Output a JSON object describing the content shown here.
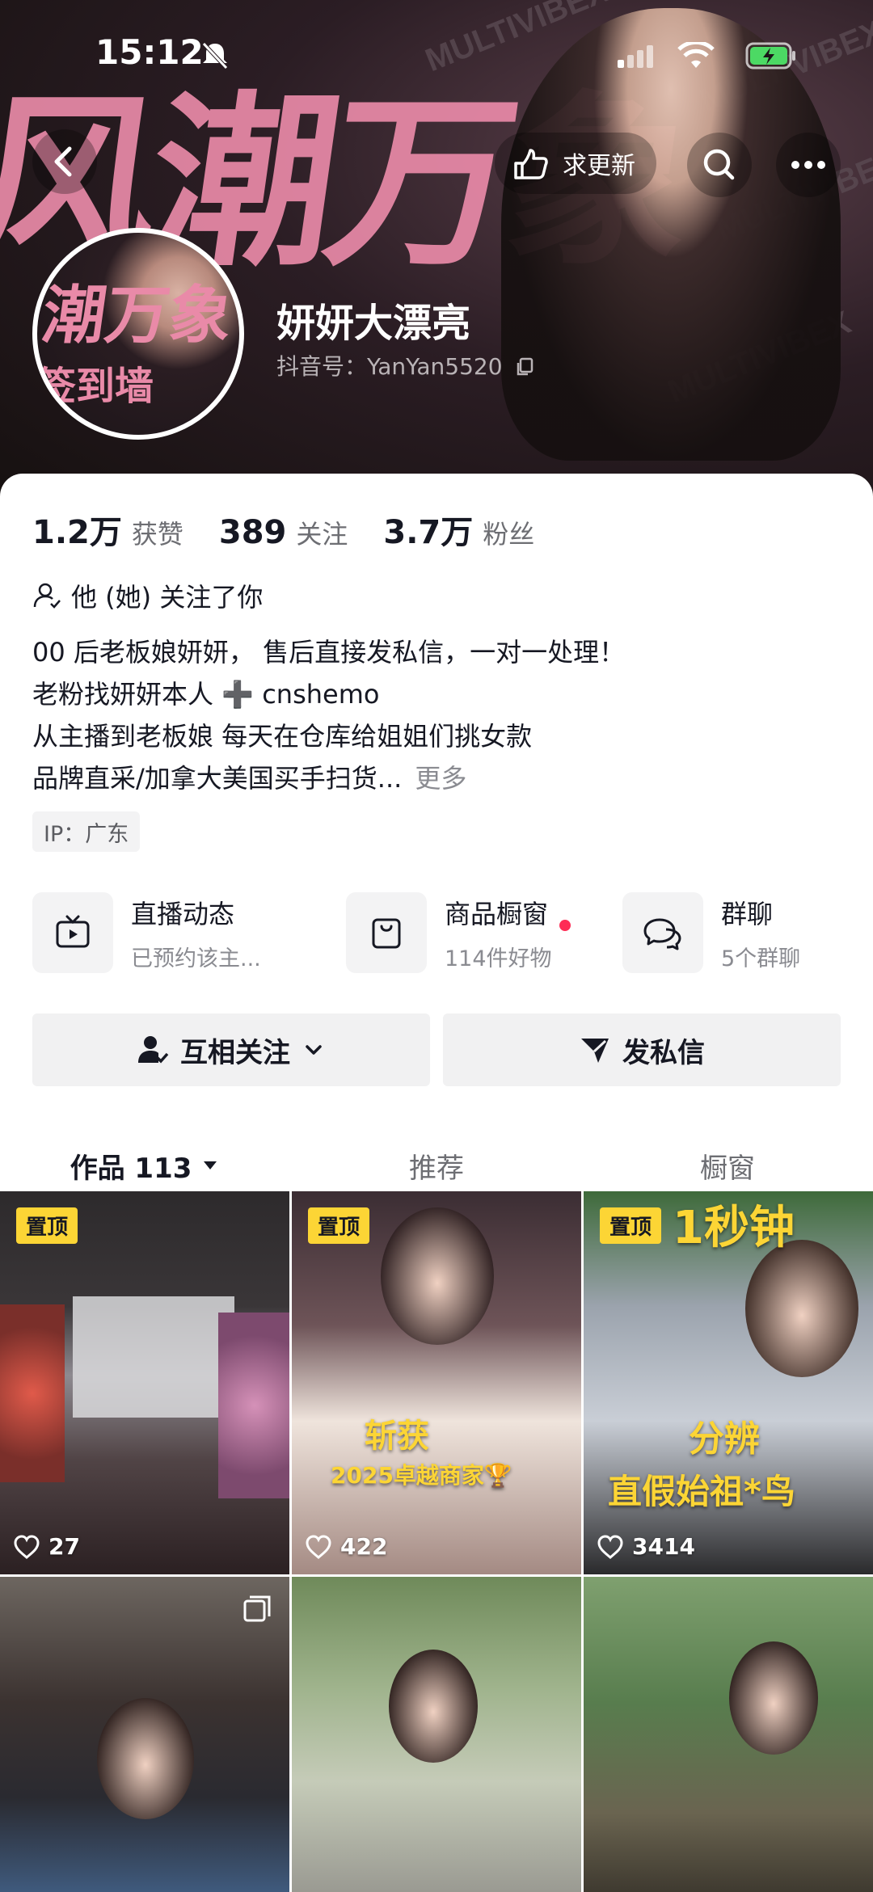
{
  "status_bar": {
    "time": "15:12"
  },
  "banner": {
    "big_text": "风潮万象",
    "brand": "MULTIVIBEX",
    "avatar_text": "潮万象",
    "avatar_subtext": "签到墙"
  },
  "nav": {
    "update_label": "求更新"
  },
  "profile": {
    "name": "妍妍大漂亮",
    "douyin_id": "抖音号：YanYan5520"
  },
  "stats": [
    {
      "value": "1.2万",
      "label": "获赞"
    },
    {
      "value": "389",
      "label": "关注"
    },
    {
      "value": "3.7万",
      "label": "粉丝"
    }
  ],
  "follow_note": "他 (她) 关注了你",
  "bio": {
    "lines": [
      "00 后老板娘妍妍， 售后直接发私信，一对一处理！",
      "老粉找妍妍本人 ➕ cnshemo",
      "从主播到老板娘 每天在仓库给姐姐们挑女款",
      "品牌直采/加拿大美国买手扫货..."
    ],
    "more": "更多"
  },
  "ip": "IP：广东",
  "services": [
    {
      "title": "直播动态",
      "subtitle": "已预约该主...",
      "icon": "tv-icon"
    },
    {
      "title": "商品橱窗",
      "subtitle": "114件好物",
      "icon": "bag-icon"
    },
    {
      "title": "群聊",
      "subtitle": "5个群聊",
      "icon": "chat-icon"
    }
  ],
  "actions": {
    "mutual_follow": "互相关注",
    "message": "发私信"
  },
  "tabs": [
    {
      "label": "作品 113",
      "active": true
    },
    {
      "label": "推荐",
      "active": false
    },
    {
      "label": "橱窗",
      "active": false
    }
  ],
  "videos": [
    {
      "pinned": "置顶",
      "likes": "27"
    },
    {
      "pinned": "置顶",
      "likes": "422",
      "caption1": "斩获",
      "caption2": "2025卓越商家🏆"
    },
    {
      "pinned": "置顶",
      "likes": "3414",
      "caption_top": "1秒钟",
      "caption1": "分辨",
      "caption2": "直假始祖*鸟"
    },
    {
      "likes": ""
    },
    {
      "likes": ""
    },
    {
      "likes": ""
    }
  ],
  "colors": {
    "accent_red": "#fe2c55",
    "pin_yellow": "#fcd535",
    "pink_banner": "#e98aa8"
  }
}
